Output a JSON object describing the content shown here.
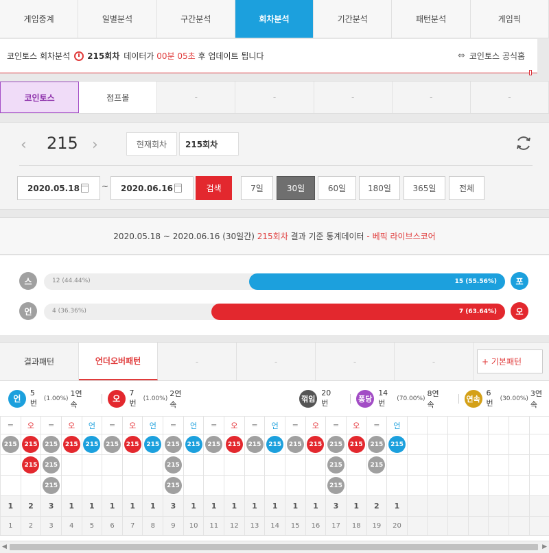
{
  "nav": {
    "tabs": [
      "게임중계",
      "일별분석",
      "구간분석",
      "회차분석",
      "기간분석",
      "패턴분석",
      "게임픽"
    ],
    "active": 3
  },
  "info": {
    "game_label": "코인토스 회차분석",
    "round": "215회차",
    "text_mid": "데이터가",
    "countdown": "00분 05초",
    "text_end": "후 업데이트 됩니다",
    "home_label": "코인토스 공식홈"
  },
  "game_tabs": [
    "코인토스",
    "점프볼",
    "-",
    "-",
    "-",
    "-",
    "-"
  ],
  "search": {
    "round_no": "215",
    "current_btn": "현재회차",
    "round_input": "215회차",
    "date_from": "2020.05.18",
    "date_to": "2020.06.16",
    "tilde": "~",
    "search_btn": "검색",
    "periods": [
      "7일",
      "30일",
      "60일",
      "180일",
      "365일",
      "전체"
    ],
    "active_period": 1
  },
  "stats": {
    "range": "2020.05.18 ~ 2020.06.16 (30일간)",
    "round": "215회차",
    "mid": "결과 기준 통계데이터",
    "source": "- 베픽 라이브스코어",
    "rows": [
      {
        "left_badge": "스",
        "right_badge": "포",
        "left_label": "12 (44.44%)",
        "right_label": "15 (55.56%)",
        "fill_pct": 55.56,
        "color": "#1ca0dd"
      },
      {
        "left_badge": "언",
        "right_badge": "오",
        "left_label": "4 (36.36%)",
        "right_label": "7 (63.64%)",
        "fill_pct": 63.64,
        "color": "#e3282e"
      }
    ]
  },
  "pattern": {
    "tabs": [
      "결과패턴",
      "언더오버패턴",
      "-",
      "-",
      "-",
      "-"
    ],
    "basic_btn": "+ 기본패턴",
    "legend": {
      "under": {
        "badge": "언",
        "count": "5번",
        "pct": "(1.00%)",
        "streak": "1연속"
      },
      "over": {
        "badge": "오",
        "count": "7번",
        "pct": "(1.00%)",
        "streak": "2연속"
      },
      "bounce": {
        "badge": "꺾임",
        "count": "20번"
      },
      "pong": {
        "badge": "퐁당",
        "count": "14번",
        "pct": "(70.00%)",
        "streak": "8연속"
      },
      "cont": {
        "badge": "연속",
        "count": "6번",
        "pct": "(30.00%)",
        "streak": "3연속"
      }
    },
    "columns": [
      {
        "h": "=",
        "c": "gray",
        "n": 1
      },
      {
        "h": "오",
        "c": "red",
        "n": 2
      },
      {
        "h": "=",
        "c": "gray",
        "n": 3
      },
      {
        "h": "오",
        "c": "red",
        "n": 1
      },
      {
        "h": "언",
        "c": "blue",
        "n": 1
      },
      {
        "h": "=",
        "c": "gray",
        "n": 1
      },
      {
        "h": "오",
        "c": "red",
        "n": 1
      },
      {
        "h": "언",
        "c": "blue",
        "n": 1
      },
      {
        "h": "=",
        "c": "gray",
        "n": 3
      },
      {
        "h": "언",
        "c": "blue",
        "n": 1
      },
      {
        "h": "=",
        "c": "gray",
        "n": 1
      },
      {
        "h": "오",
        "c": "red",
        "n": 1
      },
      {
        "h": "=",
        "c": "gray",
        "n": 1
      },
      {
        "h": "언",
        "c": "blue",
        "n": 1
      },
      {
        "h": "=",
        "c": "gray",
        "n": 1
      },
      {
        "h": "오",
        "c": "red",
        "n": 1
      },
      {
        "h": "=",
        "c": "gray",
        "n": 3
      },
      {
        "h": "오",
        "c": "red",
        "n": 1
      },
      {
        "h": "=",
        "c": "gray",
        "n": 2
      },
      {
        "h": "언",
        "c": "blue",
        "n": 1
      }
    ],
    "ball_label": "215",
    "total_columns": 27
  },
  "colors": {
    "blue": "#1ca0dd",
    "red": "#e3282e",
    "gray": "#a0a0a0",
    "purple": "#a24cc5",
    "gold": "#d4a017",
    "dark": "#555555"
  }
}
